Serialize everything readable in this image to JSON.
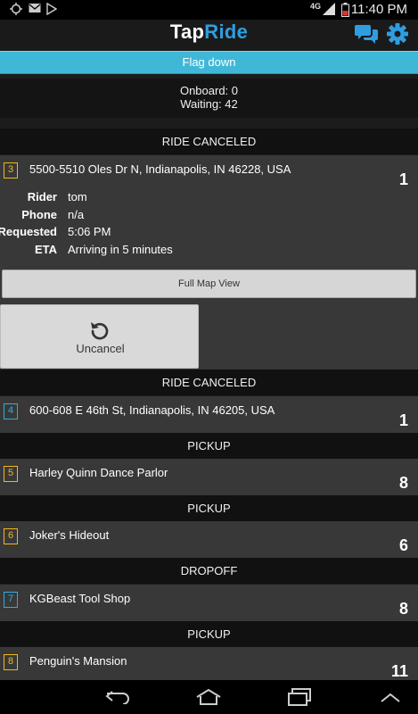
{
  "status_bar": {
    "time": "11:40 PM",
    "network": "4G",
    "icons": [
      "gps-icon",
      "mail-icon",
      "play-store-icon",
      "signal-icon",
      "battery-icon"
    ]
  },
  "app_bar": {
    "title_part1": "Tap",
    "title_part2": "Ride",
    "icons": [
      "chat-icon",
      "gear-icon"
    ],
    "accent": "#2f9ee0"
  },
  "flag_down": {
    "label": "Flag down",
    "color": "#3fb8d8"
  },
  "summary": {
    "onboard": "Onboard: 0",
    "waiting": "Waiting: 42"
  },
  "stops": [
    {
      "header": "RIDE CANCELED",
      "number": "3",
      "address": "5500-5510 Oles Dr N, Indianapolis, IN 46228, USA",
      "count": "1",
      "badge_color": "#f0b71d",
      "details": [
        {
          "label": "Rider",
          "value": "tom"
        },
        {
          "label": "Phone",
          "value": "n/a"
        },
        {
          "label": "Requested",
          "value": "5:06 PM"
        },
        {
          "label": "ETA",
          "value": "Arriving in 5 minutes"
        }
      ],
      "map_button": "Full Map View",
      "action_button": "Uncancel",
      "action_icon": "undo-icon"
    },
    {
      "header": "RIDE CANCELED",
      "number": "4",
      "address": "600-608 E 46th St, Indianapolis, IN 46205, USA",
      "count": "1",
      "badge_color": "#39a9dc"
    },
    {
      "header": "PICKUP",
      "number": "5",
      "address": "Harley Quinn Dance Parlor",
      "count": "8",
      "badge_color": "#f0b71d"
    },
    {
      "header": "PICKUP",
      "number": "6",
      "address": "Joker's Hideout",
      "count": "6",
      "badge_color": "#f0b71d"
    },
    {
      "header": "DROPOFF",
      "number": "7",
      "address": "KGBeast Tool Shop",
      "count": "8",
      "badge_color": "#39a9dc"
    },
    {
      "header": "PICKUP",
      "number": "8",
      "address": "Penguin's Mansion",
      "count": "11",
      "badge_color": "#f0b71d"
    }
  ],
  "nav_bar": {
    "icons": [
      "back-icon",
      "home-icon",
      "recent-apps-icon",
      "menu-up-icon"
    ]
  }
}
